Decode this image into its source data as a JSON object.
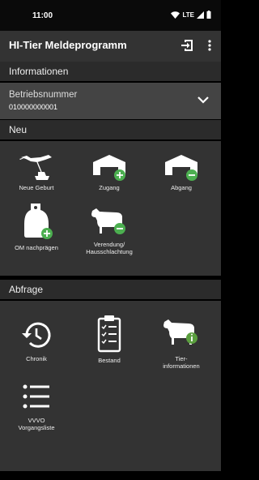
{
  "status": {
    "time": "11:00",
    "network": "LTE"
  },
  "appbar": {
    "title": "HI-Tier Meldeprogramm"
  },
  "info": {
    "header": "Informationen",
    "label": "Betriebsnummer",
    "number": "010000000001"
  },
  "neu": {
    "header": "Neu",
    "tiles": [
      {
        "label": "Neue Geburt"
      },
      {
        "label": "Zugang"
      },
      {
        "label": "Abgang"
      },
      {
        "label": "OM nachprägen"
      },
      {
        "label": "Verendung/\nHausschlachtung"
      }
    ]
  },
  "abfrage": {
    "header": "Abfrage",
    "tiles": [
      {
        "label": "Chronik"
      },
      {
        "label": "Bestand"
      },
      {
        "label": "Tier-\ninformationen"
      },
      {
        "label": "VVVO\nVorgangsliste"
      }
    ]
  },
  "colors": {
    "plus_badge": "#4caf50",
    "minus_badge": "#4caf50",
    "info_badge": "#5a9e3e"
  }
}
